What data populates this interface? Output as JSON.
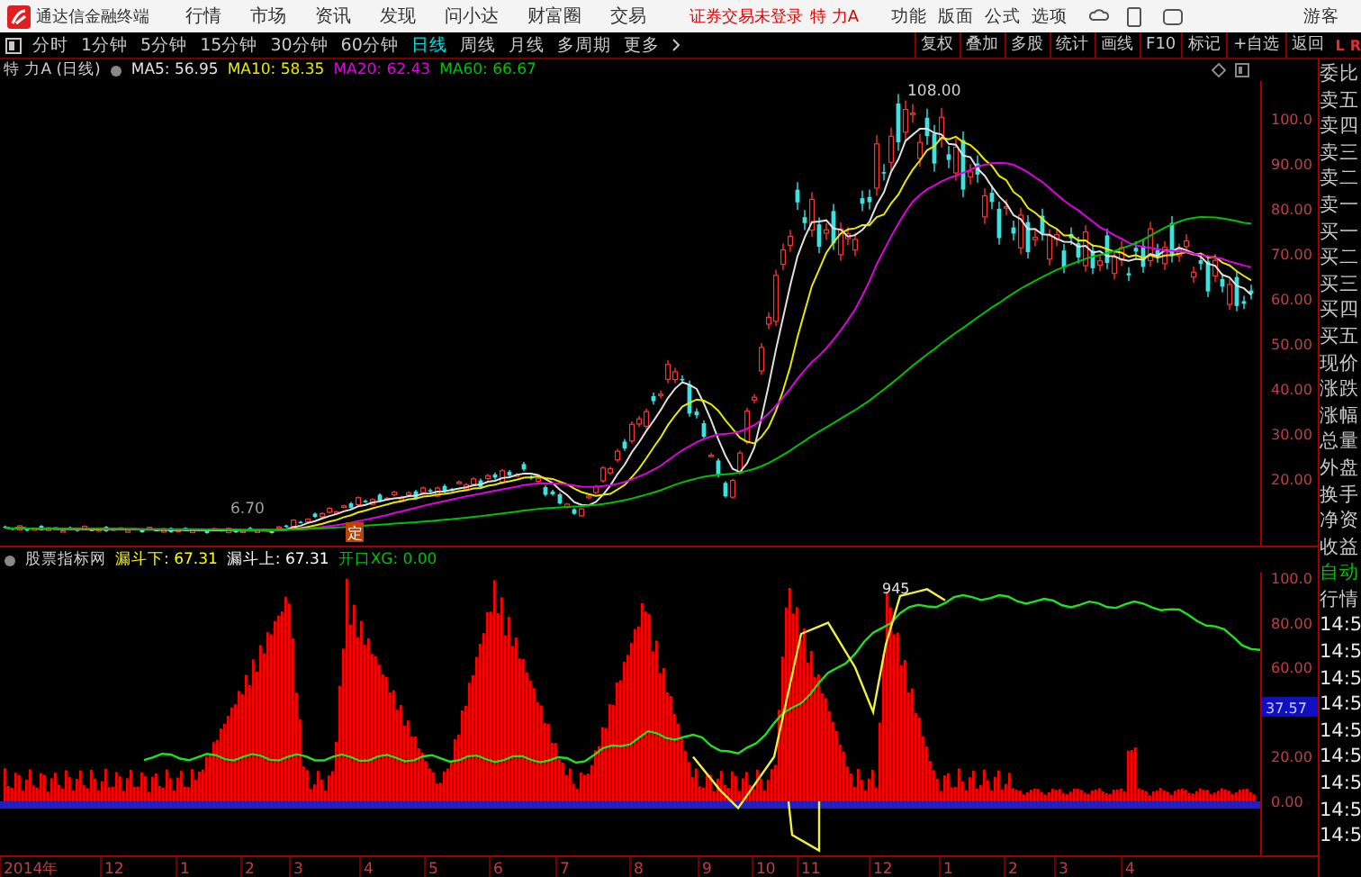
{
  "app": {
    "title": "通达信金融终端"
  },
  "menu": [
    "行情",
    "市场",
    "资讯",
    "发现",
    "问小达",
    "财富圈",
    "交易"
  ],
  "login_status": "证券交易未登录",
  "stock_name": "特 力A",
  "utility_menu": [
    "功能",
    "版面",
    "公式",
    "选项"
  ],
  "user": "游客",
  "periods": [
    {
      "label": "分时",
      "selected": false
    },
    {
      "label": "1分钟",
      "selected": false
    },
    {
      "label": "5分钟",
      "selected": false
    },
    {
      "label": "15分钟",
      "selected": false
    },
    {
      "label": "30分钟",
      "selected": false
    },
    {
      "label": "60分钟",
      "selected": false
    },
    {
      "label": "日线",
      "selected": true
    },
    {
      "label": "周线",
      "selected": false
    },
    {
      "label": "月线",
      "selected": false
    },
    {
      "label": "多周期",
      "selected": false
    }
  ],
  "more": "更多",
  "tools": [
    "复权",
    "叠加",
    "多股",
    "统计",
    "画线",
    "F10",
    "标记",
    "+自选",
    "返回"
  ],
  "corner_marks": [
    "L",
    "R"
  ],
  "price_chart": {
    "title": "特 力A (日线)",
    "ma": [
      {
        "label": "MA5: 56.95",
        "color": "#e0e0e0"
      },
      {
        "label": "MA10: 58.35",
        "color": "#e8e800"
      },
      {
        "label": "MA20: 62.43",
        "color": "#e000e0"
      },
      {
        "label": "MA60: 66.67",
        "color": "#00c000"
      }
    ],
    "yaxis": [
      "100.0",
      "90.00",
      "80.00",
      "70.00",
      "60.00",
      "50.00",
      "40.00",
      "30.00",
      "20.00"
    ],
    "high_label": "108.00",
    "low_label": "6.70",
    "marker": "定"
  },
  "indicator": {
    "name": "股票指标网",
    "values": [
      {
        "label": "漏斗下: 67.31",
        "color": "#ffff00"
      },
      {
        "label": "漏斗上: 67.31",
        "color": "#ffffff"
      },
      {
        "label": "开口XG: 0.00",
        "color": "#00c000"
      }
    ],
    "peak_label": "945",
    "yaxis": [
      "100.0",
      "80.00",
      "60.00",
      "20.00",
      "0.00"
    ],
    "current": "37.57"
  },
  "dates": [
    "2014年",
    "12",
    "1",
    "2",
    "3",
    "4",
    "5",
    "6",
    "7",
    "8",
    "9",
    "10",
    "11",
    "12",
    "1",
    "2",
    "3",
    "4"
  ],
  "sidebar": [
    {
      "label": "委比",
      "color": "#c8c8c8"
    },
    {
      "label": "卖五",
      "color": "#c8c8c8"
    },
    {
      "label": "卖四",
      "color": "#c8c8c8"
    },
    {
      "label": "卖三",
      "color": "#c8c8c8"
    },
    {
      "label": "卖二",
      "color": "#c8c8c8"
    },
    {
      "label": "卖一",
      "color": "#c8c8c8"
    },
    {
      "label": "买一",
      "color": "#c8c8c8"
    },
    {
      "label": "买二",
      "color": "#c8c8c8"
    },
    {
      "label": "买三",
      "color": "#c8c8c8"
    },
    {
      "label": "买四",
      "color": "#c8c8c8"
    },
    {
      "label": "买五",
      "color": "#c8c8c8"
    },
    {
      "label": "现价",
      "color": "#c8c8c8"
    },
    {
      "label": "涨跌",
      "color": "#c8c8c8"
    },
    {
      "label": "涨幅",
      "color": "#c8c8c8"
    },
    {
      "label": "总量",
      "color": "#c8c8c8"
    },
    {
      "label": "外盘",
      "color": "#c8c8c8"
    },
    {
      "label": "换手",
      "color": "#c8c8c8"
    },
    {
      "label": "净资",
      "color": "#c8c8c8"
    },
    {
      "label": "收益",
      "color": "#c8c8c8"
    },
    {
      "label": "自动",
      "color": "#00c000"
    },
    {
      "label": "行情",
      "color": "#c8c8c8"
    },
    {
      "label": "14:5",
      "color": "#e8e8e8"
    },
    {
      "label": "14:5",
      "color": "#e8e8e8"
    },
    {
      "label": "14:5",
      "color": "#e8e8e8"
    },
    {
      "label": "14:5",
      "color": "#e8e8e8"
    },
    {
      "label": "14:5",
      "color": "#e8e8e8"
    },
    {
      "label": "14:5",
      "color": "#e8e8e8"
    },
    {
      "label": "14:5",
      "color": "#e8e8e8"
    },
    {
      "label": "14:5",
      "color": "#e8e8e8"
    },
    {
      "label": "14:5",
      "color": "#e8e8e8"
    }
  ]
}
